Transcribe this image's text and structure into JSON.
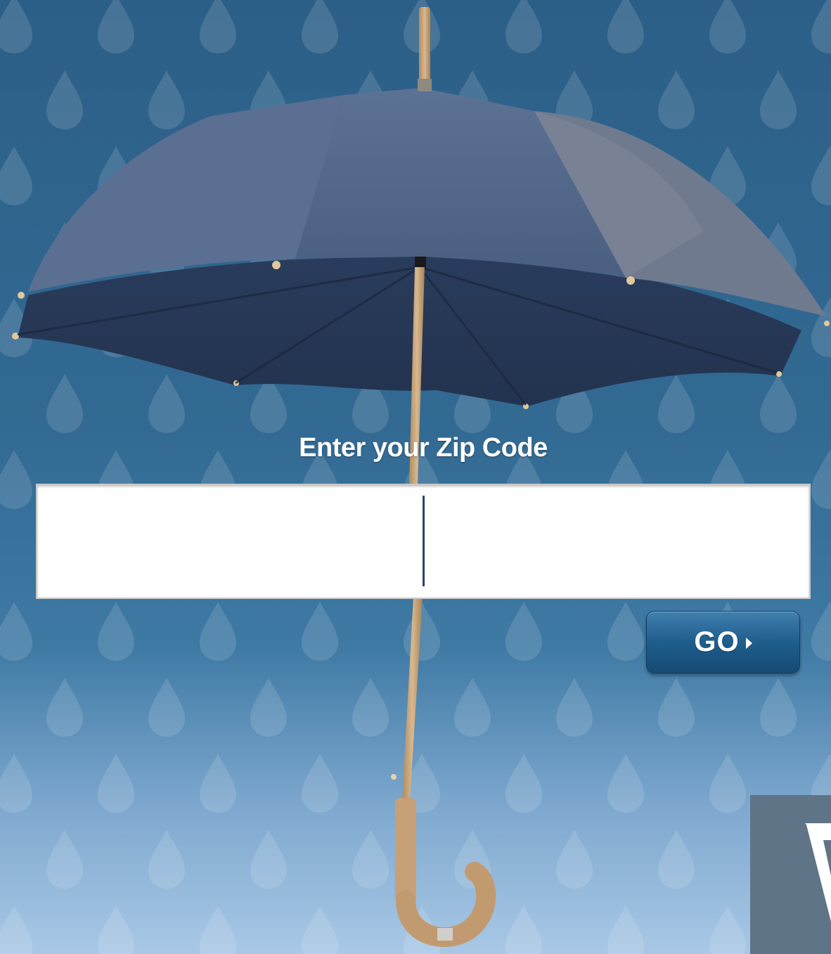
{
  "form": {
    "label": "Enter your Zip Code",
    "zip_value": "",
    "go_label": "GO",
    "go_icon": "chevron-right-icon"
  },
  "background": {
    "illustration": "umbrella-in-rain",
    "colors": {
      "sky_top": "#2c5f87",
      "sky_bottom": "#a9c8e6",
      "canopy": "#4a6283",
      "handle": "#c9a57a",
      "button": "#1f5d8c"
    }
  }
}
